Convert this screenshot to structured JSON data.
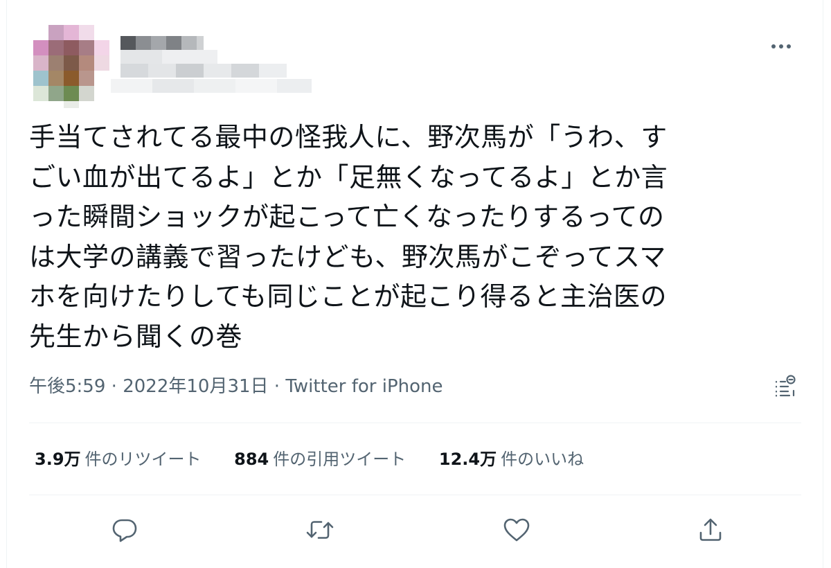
{
  "author": {
    "avatar_image": "pixelated-avatar",
    "name_image": "pixelated-name-and-handle"
  },
  "more_icon": "ellipsis-icon",
  "tweet": {
    "lines": [
      "手当てされてる最中の怪我人に、野次馬が「うわ、す",
      "ごい血が出てるよ」とか「足無くなってるよ」とか言",
      "った瞬間ショックが起こって亡くなったりするっての",
      "は大学の講義で習ったけども、野次馬がこぞってスマ",
      "ホを向けたりしても同じことが起こり得ると主治医の",
      "先生から聞くの巻"
    ]
  },
  "meta": {
    "time": "午後5:59",
    "separator": "·",
    "date": "2022年10月31日",
    "source": "Twitter for iPhone"
  },
  "stats": {
    "retweets_count": "3.9万",
    "retweets_label": "件のリツイート",
    "quotes_count": "884",
    "quotes_label": "件の引用ツイート",
    "likes_count": "12.4万",
    "likes_label": "件のいいね"
  },
  "actions": [
    "reply-icon",
    "retweet-icon",
    "like-icon",
    "share-icon"
  ],
  "colors": {
    "text": "#0f1419",
    "secondary": "#536471",
    "divider": "#eff3f4"
  }
}
